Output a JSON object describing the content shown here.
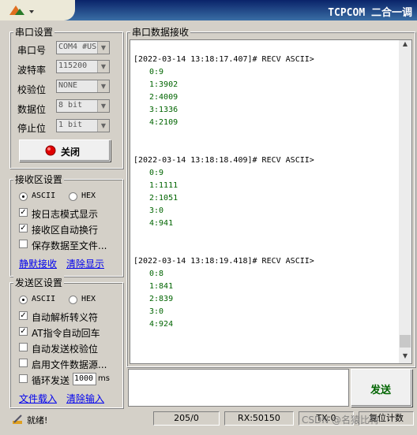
{
  "window": {
    "title": "TCPCOM 二合一调"
  },
  "serial_settings": {
    "title": "串口设置",
    "port": {
      "label": "串口号",
      "value": "COM4 #US"
    },
    "baud": {
      "label": "波特率",
      "value": "115200"
    },
    "parity": {
      "label": "校验位",
      "value": "NONE"
    },
    "databits": {
      "label": "数据位",
      "value": "8 bit"
    },
    "stopbits": {
      "label": "停止位",
      "value": "1 bit"
    },
    "close_button": "关闭"
  },
  "recv_settings": {
    "title": "接收区设置",
    "ascii": "ASCII",
    "hex": "HEX",
    "log_mode": "按日志模式显示",
    "auto_wrap": "接收区自动换行",
    "save_to_file": "保存数据至文件...",
    "silent_recv": "静默接收",
    "clear_display": "清除显示"
  },
  "send_settings": {
    "title": "发送区设置",
    "ascii": "ASCII",
    "hex": "HEX",
    "auto_escape": "自动解析转义符",
    "at_cr": "AT指令自动回车",
    "auto_checksum": "自动发送校验位",
    "file_source": "启用文件数据源...",
    "loop_send": "循环发送",
    "loop_ms": "1000",
    "ms_unit": "ms",
    "load_file": "文件载入",
    "clear_input": "清除输入"
  },
  "recv_panel": {
    "title": "串口数据接收",
    "entries": [
      {
        "header": "[2022-03-14 13:18:17.407]# RECV ASCII>",
        "lines": [
          "0:9",
          "1:3902",
          "2:4009",
          "3:1336",
          "4:2109"
        ]
      },
      {
        "header": "[2022-03-14 13:18:18.409]# RECV ASCII>",
        "lines": [
          "0:9",
          "1:1111",
          "2:1051",
          "3:0",
          "4:941"
        ]
      },
      {
        "header": "[2022-03-14 13:18:19.418]# RECV ASCII>",
        "lines": [
          "0:8",
          "1:841",
          "2:839",
          "3:0",
          "4:924"
        ]
      }
    ]
  },
  "send_button": "发送",
  "status_bar": {
    "ready": "就绪!",
    "counts": "205/0",
    "rx": "RX:50150",
    "tx": "TX:0",
    "reset": "复位计数"
  },
  "watermark": "CSDN @名猿比特"
}
